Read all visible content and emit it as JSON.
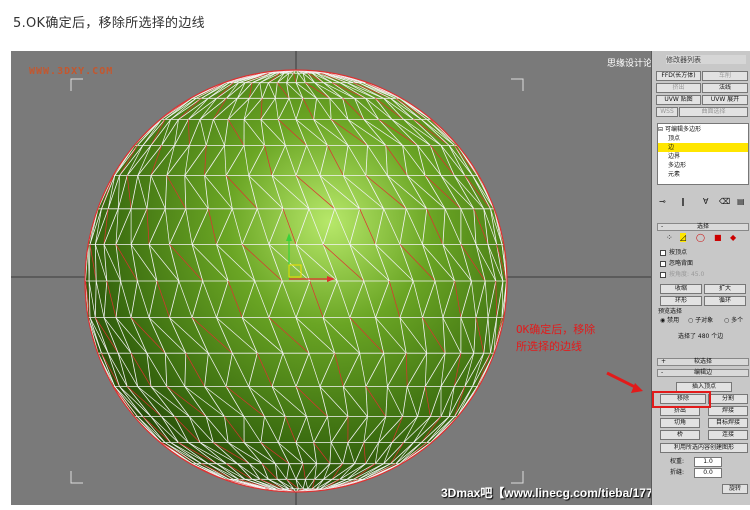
{
  "heading": "5.OK确定后，移除所选择的边线",
  "watermark_left": "WWW.3DXY.COM",
  "watermark_right": "思缘设计论坛 WWW.MISSYUAN.COM",
  "watermark_bottom": "3Dmax吧【www.linecg.com/tieba/1771】",
  "annotation": {
    "line1": "OK确定后，移除",
    "line2": "所选择的边线"
  },
  "colors": {
    "sphere": "#4e8a14",
    "wire_white": "#f4f4f4",
    "wire_red": "#e03030",
    "highlight": "#ffe600",
    "annotation": "#e21b1b"
  },
  "panel": {
    "title": "修改器列表",
    "modifier_buttons": [
      "FFD(长方体)",
      "车削",
      "挤出",
      "法线",
      "UVW 贴图",
      "UVW 展开",
      "对称",
      "涡轮平滑",
      "WSS",
      "曲面选择"
    ],
    "stack": {
      "root": "可编辑多边形",
      "items": [
        "顶点",
        "边",
        "边界",
        "多边形",
        "元素"
      ],
      "selected": "边"
    },
    "selection_rollout": "选择",
    "checks": [
      "按顶点",
      "忽略背面",
      "按角度:"
    ],
    "angle_value": "45.0",
    "shrink": "收缩",
    "grow": "扩大",
    "ring": "环形",
    "loop": "循环",
    "preview_label": "预览选择",
    "preview_options": [
      "禁用",
      "子对象",
      "多个"
    ],
    "selection_count": "选择了 480 个边",
    "soft_selection": "软选择",
    "edit_edges": "编辑边",
    "insert_vertex": "插入顶点",
    "remove": "移除",
    "split": "分割",
    "extrude": "挤出",
    "weld": "焊接",
    "chamfer": "切角",
    "target_weld": "目标焊接",
    "bridge": "桥",
    "connect": "连接",
    "create_shape": "利用所选内容创建图形",
    "weight_label": "权重:",
    "weight_value": "1.0",
    "crease_label": "折缝:",
    "crease_value": "0.0",
    "rotate": "旋转"
  }
}
